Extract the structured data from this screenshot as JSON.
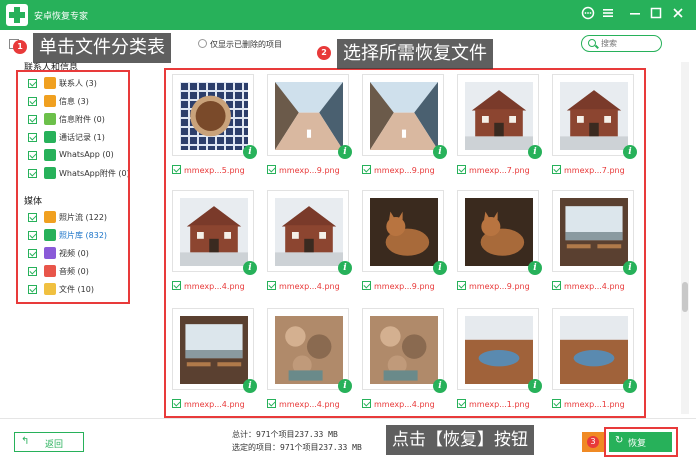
{
  "app": {
    "title": "安卓恢复专家"
  },
  "toolbar": {
    "only_deleted_label": "仅显示已删除的项目",
    "search_placeholder": "搜索"
  },
  "sidebar": {
    "contacts_header": "联系人和信息",
    "media_header": "媒体",
    "contact_items": [
      {
        "label": "联系人 (3)",
        "icon": "contacts-icon",
        "color": "#f0a020"
      },
      {
        "label": "信息 (3)",
        "icon": "message-icon",
        "color": "#f0a020"
      },
      {
        "label": "信息附件 (0)",
        "icon": "attachment-icon",
        "color": "#6cc04a"
      },
      {
        "label": "通话记录 (1)",
        "icon": "call-log-icon",
        "color": "#27b15a"
      },
      {
        "label": "WhatsApp (0)",
        "icon": "whatsapp-icon",
        "color": "#27b15a"
      },
      {
        "label": "WhatsApp附件 (0)",
        "icon": "whatsapp-attachment-icon",
        "color": "#27b15a"
      }
    ],
    "media_items": [
      {
        "label": "照片流 (122)",
        "icon": "photo-stream-icon",
        "color": "#f0a020"
      },
      {
        "label": "照片库 (832)",
        "icon": "photo-library-icon",
        "color": "#27b15a"
      },
      {
        "label": "视频 (0)",
        "icon": "video-icon",
        "color": "#8a5ad8"
      },
      {
        "label": "音频 (0)",
        "icon": "audio-icon",
        "color": "#e8554a"
      },
      {
        "label": "文件 (10)",
        "icon": "files-icon",
        "color": "#f0c040"
      }
    ]
  },
  "annotations": {
    "step1": {
      "num": "1",
      "text": "单击文件分类表"
    },
    "step2": {
      "num": "2",
      "text": "选择所需恢复文件"
    },
    "step3": {
      "num": "3",
      "text": "点击【恢复】按钮"
    }
  },
  "grid": {
    "files": [
      {
        "name": "mmexp...5.png",
        "image": "food-bowl"
      },
      {
        "name": "mmexp...9.png",
        "image": "street"
      },
      {
        "name": "mmexp...9.png",
        "image": "street"
      },
      {
        "name": "mmexp...7.png",
        "image": "house"
      },
      {
        "name": "mmexp...7.png",
        "image": "house"
      },
      {
        "name": "mmexp...4.png",
        "image": "house"
      },
      {
        "name": "mmexp...4.png",
        "image": "house"
      },
      {
        "name": "mmexp...9.png",
        "image": "cat"
      },
      {
        "name": "mmexp...9.png",
        "image": "cat"
      },
      {
        "name": "mmexp...4.png",
        "image": "window-view"
      },
      {
        "name": "mmexp...4.png",
        "image": "window-view"
      },
      {
        "name": "mmexp...4.png",
        "image": "rocks"
      },
      {
        "name": "mmexp...4.png",
        "image": "rocks"
      },
      {
        "name": "mmexp...1.png",
        "image": "pond"
      },
      {
        "name": "mmexp...1.png",
        "image": "pond"
      }
    ]
  },
  "footer": {
    "back_label": "返回",
    "total_line": "总计：971个项目237.33 MB",
    "selected_line": "选定的项目：971个项目237.33 MB",
    "recover_label": "恢复"
  },
  "colors": {
    "accent": "#27b15a",
    "annotation": "#e83a3a"
  }
}
